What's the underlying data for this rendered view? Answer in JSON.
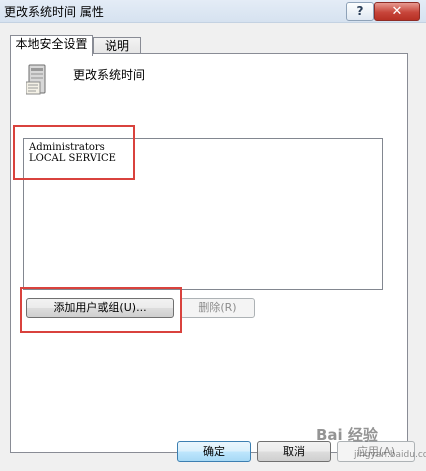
{
  "window": {
    "title": "更改系统时间 属性",
    "help_label": "?",
    "close_label": "✕"
  },
  "tabs": [
    {
      "label": "本地安全设置",
      "active": true
    },
    {
      "label": "说明",
      "active": false
    }
  ],
  "policy": {
    "name": "更改系统时间",
    "icon": "server-icon"
  },
  "accounts": [
    "Administrators",
    "LOCAL SERVICE"
  ],
  "buttons": {
    "add_label": "添加用户或组(U)...",
    "remove_label": "删除(R)",
    "ok_label": "确定",
    "cancel_label": "取消",
    "apply_label": "应用(A)"
  },
  "annotation_color": "#d9423d",
  "watermark": {
    "logo": "Bai 经验",
    "sub": "jingyan.baidu.com"
  }
}
